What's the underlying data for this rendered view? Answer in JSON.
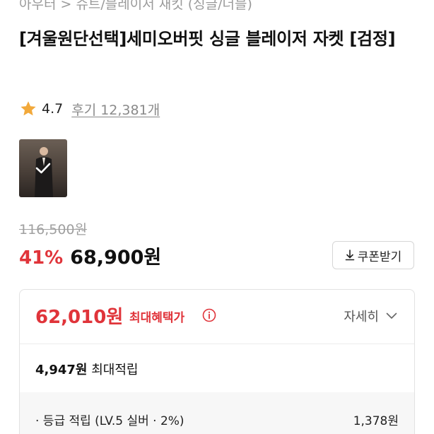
{
  "breadcrumb": "아우터 > 슈트/블레이저 재킷 (싱글/더블)",
  "product": {
    "title": "[겨울원단선택]세미오버핏 싱글 블레이저 자켓 [검정]",
    "rating": "4.7",
    "review_text": "후기 12,381개"
  },
  "pricing": {
    "original_price": "116,500원",
    "discount": "41%",
    "sale_price": "68,900원",
    "coupon_label": "쿠폰받기"
  },
  "benefits": {
    "max_price": "62,010원",
    "max_label": "최대혜택가",
    "details_label": "자세히",
    "points_amount": "4,947원",
    "points_label": "최대적립",
    "grade_label": "· 등급 적립 (LV.5 실버 · 2%)",
    "grade_value": "1,378원"
  },
  "colors": {
    "accent": "#e0343a",
    "star": "#f2a93b"
  },
  "icons": [
    "star-icon",
    "check-icon",
    "download-icon",
    "info-icon",
    "chevron-down-icon"
  ]
}
